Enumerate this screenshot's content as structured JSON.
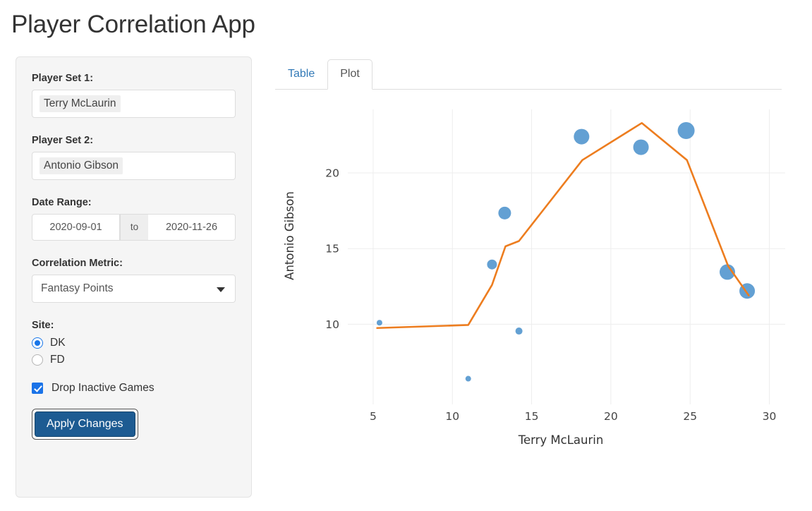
{
  "page": {
    "title": "Player Correlation App"
  },
  "sidebar": {
    "player_set_1": {
      "label": "Player Set 1:",
      "value": "Terry McLaurin"
    },
    "player_set_2": {
      "label": "Player Set 2:",
      "value": "Antonio Gibson"
    },
    "date_range": {
      "label": "Date Range:",
      "start": "2020-09-01",
      "separator": "to",
      "end": "2020-11-26"
    },
    "correlation_metric": {
      "label": "Correlation Metric:",
      "value": "Fantasy Points",
      "options": [
        "Fantasy Points"
      ]
    },
    "site": {
      "label": "Site:",
      "options": [
        {
          "label": "DK",
          "checked": true
        },
        {
          "label": "FD",
          "checked": false
        }
      ]
    },
    "drop_inactive": {
      "label": "Drop Inactive Games",
      "checked": true
    },
    "apply_button": "Apply Changes"
  },
  "main": {
    "tabs": [
      {
        "label": "Table",
        "active": false
      },
      {
        "label": "Plot",
        "active": true
      }
    ]
  },
  "chart_data": {
    "type": "scatter",
    "title": "",
    "xlabel": "Terry McLaurin",
    "ylabel": "Antonio Gibson",
    "xlim": [
      3.4,
      31.0
    ],
    "ylim": [
      4.7,
      24.2
    ],
    "xticks": [
      5,
      10,
      15,
      20,
      25,
      30
    ],
    "yticks": [
      10,
      15,
      20
    ],
    "grid": true,
    "legend": "none",
    "colors": {
      "marker": "#5b9bd1",
      "line": "#ed7d1f",
      "grid": "#ededed"
    },
    "series": [
      {
        "name": "scatter",
        "type": "scatter",
        "marker_color": "#5b9bd1",
        "points": [
          {
            "x": 5.4,
            "y": 10.1,
            "size": 4
          },
          {
            "x": 11.0,
            "y": 6.4,
            "size": 4
          },
          {
            "x": 12.5,
            "y": 13.95,
            "size": 7
          },
          {
            "x": 13.3,
            "y": 17.35,
            "size": 9
          },
          {
            "x": 14.2,
            "y": 9.55,
            "size": 5
          },
          {
            "x": 18.15,
            "y": 22.4,
            "size": 11
          },
          {
            "x": 21.9,
            "y": 21.7,
            "size": 11
          },
          {
            "x": 24.75,
            "y": 22.8,
            "size": 12
          },
          {
            "x": 27.35,
            "y": 13.45,
            "size": 11
          },
          {
            "x": 28.6,
            "y": 12.2,
            "size": 11
          }
        ]
      },
      {
        "name": "trend",
        "type": "line",
        "line_color": "#ed7d1f",
        "points": [
          {
            "x": 5.25,
            "y": 9.75
          },
          {
            "x": 11.0,
            "y": 9.95
          },
          {
            "x": 12.5,
            "y": 12.6
          },
          {
            "x": 13.35,
            "y": 15.15
          },
          {
            "x": 14.2,
            "y": 15.5
          },
          {
            "x": 18.2,
            "y": 20.85
          },
          {
            "x": 21.95,
            "y": 23.3
          },
          {
            "x": 24.8,
            "y": 20.85
          },
          {
            "x": 27.4,
            "y": 13.85
          },
          {
            "x": 28.7,
            "y": 11.9
          }
        ]
      }
    ]
  }
}
